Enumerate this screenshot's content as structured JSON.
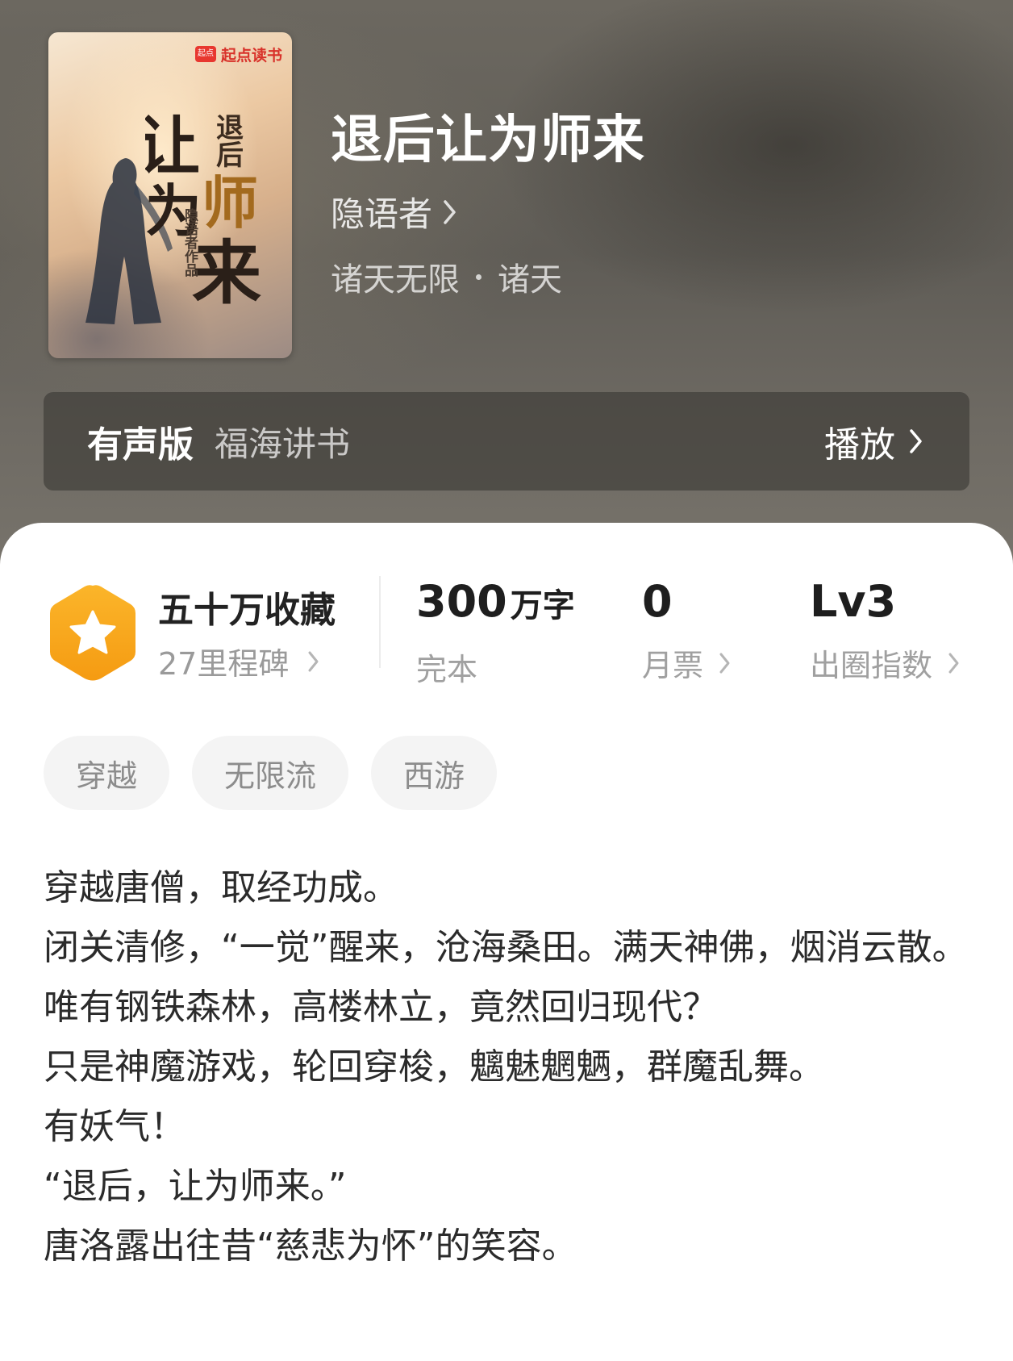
{
  "cover": {
    "logo_mark": "起点",
    "logo_text": "起点读书",
    "title_art": "退后让为师来",
    "author_stamp": "隐语者作品"
  },
  "book": {
    "title": "退后让为师来",
    "author": "隐语者",
    "genre_primary": "诸天无限",
    "genre_secondary": "诸天"
  },
  "audio": {
    "label": "有声版",
    "narrator": "福海讲书",
    "play_label": "播放"
  },
  "stats": {
    "collection": "五十万收藏",
    "milestones": "27里程碑",
    "word_count_value": "300",
    "word_count_unit": "万字",
    "status": "完本",
    "monthly_ticket_value": "0",
    "monthly_ticket_label": "月票",
    "circle_index_value": "Lv3",
    "circle_index_label": "出圈指数"
  },
  "tags": [
    "穿越",
    "无限流",
    "西游"
  ],
  "synopsis": [
    "穿越唐僧，取经功成。",
    "闭关清修，“一觉”醒来，沧海桑田。满天神佛，烟消云散。",
    "唯有钢铁森林，高楼林立，竟然回归现代？",
    "只是神魔游戏，轮回穿梭，魑魅魍魉，群魔乱舞。",
    "有妖气！",
    "“退后，让为师来。”",
    "唐洛露出往昔“慈悲为怀”的笑容。"
  ],
  "colors": {
    "badge_orange": "#f7a21b",
    "hero_bg": "#625f59",
    "text_dark": "#222222",
    "text_muted": "#9a9a9a"
  }
}
